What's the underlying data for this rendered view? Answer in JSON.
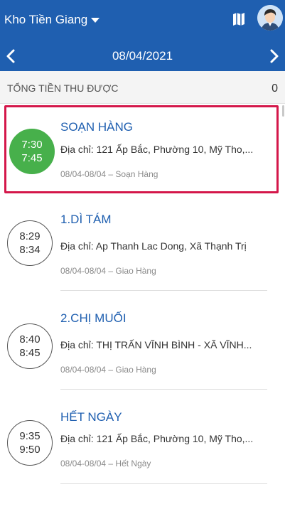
{
  "header": {
    "warehouse": "Kho Tiền Giang",
    "map_icon": "map-icon",
    "avatar_icon": "user-avatar-icon",
    "date": "08/04/2021",
    "prev_icon": "chevron-left-icon",
    "next_icon": "chevron-right-icon",
    "bg_color": "#1f5fb0"
  },
  "summary": {
    "label": "TỔNG TIỀN THU ĐƯỢC",
    "value": "0"
  },
  "stops": [
    {
      "start": "7:30",
      "end": "7:45",
      "title": "SOẠN HÀNG",
      "address": "Địa chỉ: 121 Ấp Bắc, Phường 10, Mỹ Tho,...",
      "meta": "08/04-08/04 – Soạn Hàng",
      "status_color": "#47b04b"
    },
    {
      "start": "8:29",
      "end": "8:34",
      "title": "1.DÌ TÁM",
      "address": "Địa chỉ: Ap Thanh Lac Dong, Xã Thạnh Trị",
      "meta": "08/04-08/04 – Giao Hàng"
    },
    {
      "start": "8:40",
      "end": "8:45",
      "title": "2.CHỊ  MUỐI",
      "address": "Địa chỉ: THỊ TRẤN VĨNH BÌNH - XÃ VĨNH...",
      "meta": "08/04-08/04 – Giao Hàng"
    },
    {
      "start": "9:35",
      "end": "9:50",
      "title": "HẾT NGÀY",
      "address": "Địa chỉ: 121 Ấp Bắc, Phường 10, Mỹ Tho,...",
      "meta": "08/04-08/04 – Hết Ngày"
    }
  ],
  "colors": {
    "accent": "#1f5fb0",
    "highlight": "#d4174a",
    "active": "#47b04b"
  }
}
